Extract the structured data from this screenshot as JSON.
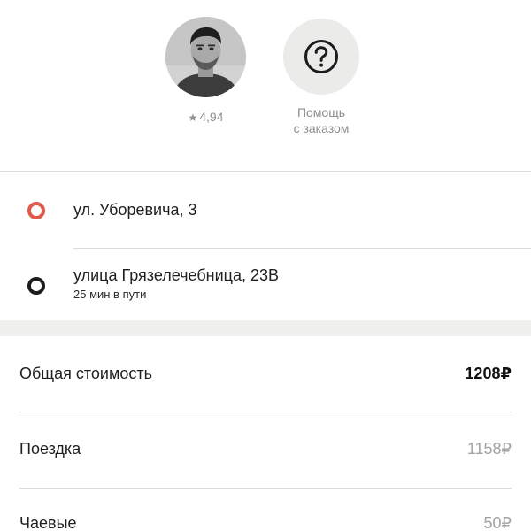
{
  "driver": {
    "rating": "4,94",
    "rating_icon": "star-icon"
  },
  "help": {
    "icon": "question-circle-icon",
    "label_line1": "Помощь",
    "label_line2": "с заказом"
  },
  "route": {
    "origin": {
      "address": "ул. Уборевича, 3",
      "dot_color": "#e05a4c"
    },
    "destination": {
      "address": "улица Грязелечебница, 23В",
      "eta": "25 мин в пути",
      "dot_color": "#1c1c1c"
    }
  },
  "cost": {
    "total_label": "Общая стоимость",
    "total_value": "1208₽",
    "items": [
      {
        "label": "Поездка",
        "value": "1158₽"
      },
      {
        "label": "Чаевые",
        "value": "50₽"
      }
    ]
  }
}
